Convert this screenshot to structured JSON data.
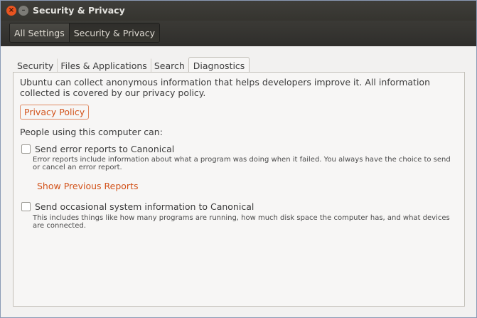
{
  "window": {
    "title": "Security & Privacy",
    "close_glyph": "×",
    "minimize_glyph": "–"
  },
  "toolbar": {
    "crumbs": [
      {
        "label": "All Settings"
      },
      {
        "label": "Security & Privacy"
      }
    ]
  },
  "tabs": [
    {
      "label": "Security"
    },
    {
      "label": "Files & Applications"
    },
    {
      "label": "Search"
    },
    {
      "label": "Diagnostics",
      "active": true
    }
  ],
  "diagnostics": {
    "intro": "Ubuntu can collect anonymous information that helps developers improve it. All information collected is covered by our privacy policy.",
    "privacy_button": "Privacy Policy",
    "people_label": "People using this computer can:",
    "error_reports": {
      "label": "Send error reports to Canonical",
      "checked": false,
      "description": "Error reports include information about what a program was doing when it failed. You always have the choice to send or cancel an error report.",
      "link": "Show Previous Reports"
    },
    "system_info": {
      "label": "Send occasional system information to Canonical",
      "checked": false,
      "description": "This includes things like how many programs are running, how much disk space the computer has, and what devices are connected."
    }
  },
  "colors": {
    "accent": "#d2521a",
    "close_button": "#e95420",
    "titlebar": "#3c3b37"
  }
}
